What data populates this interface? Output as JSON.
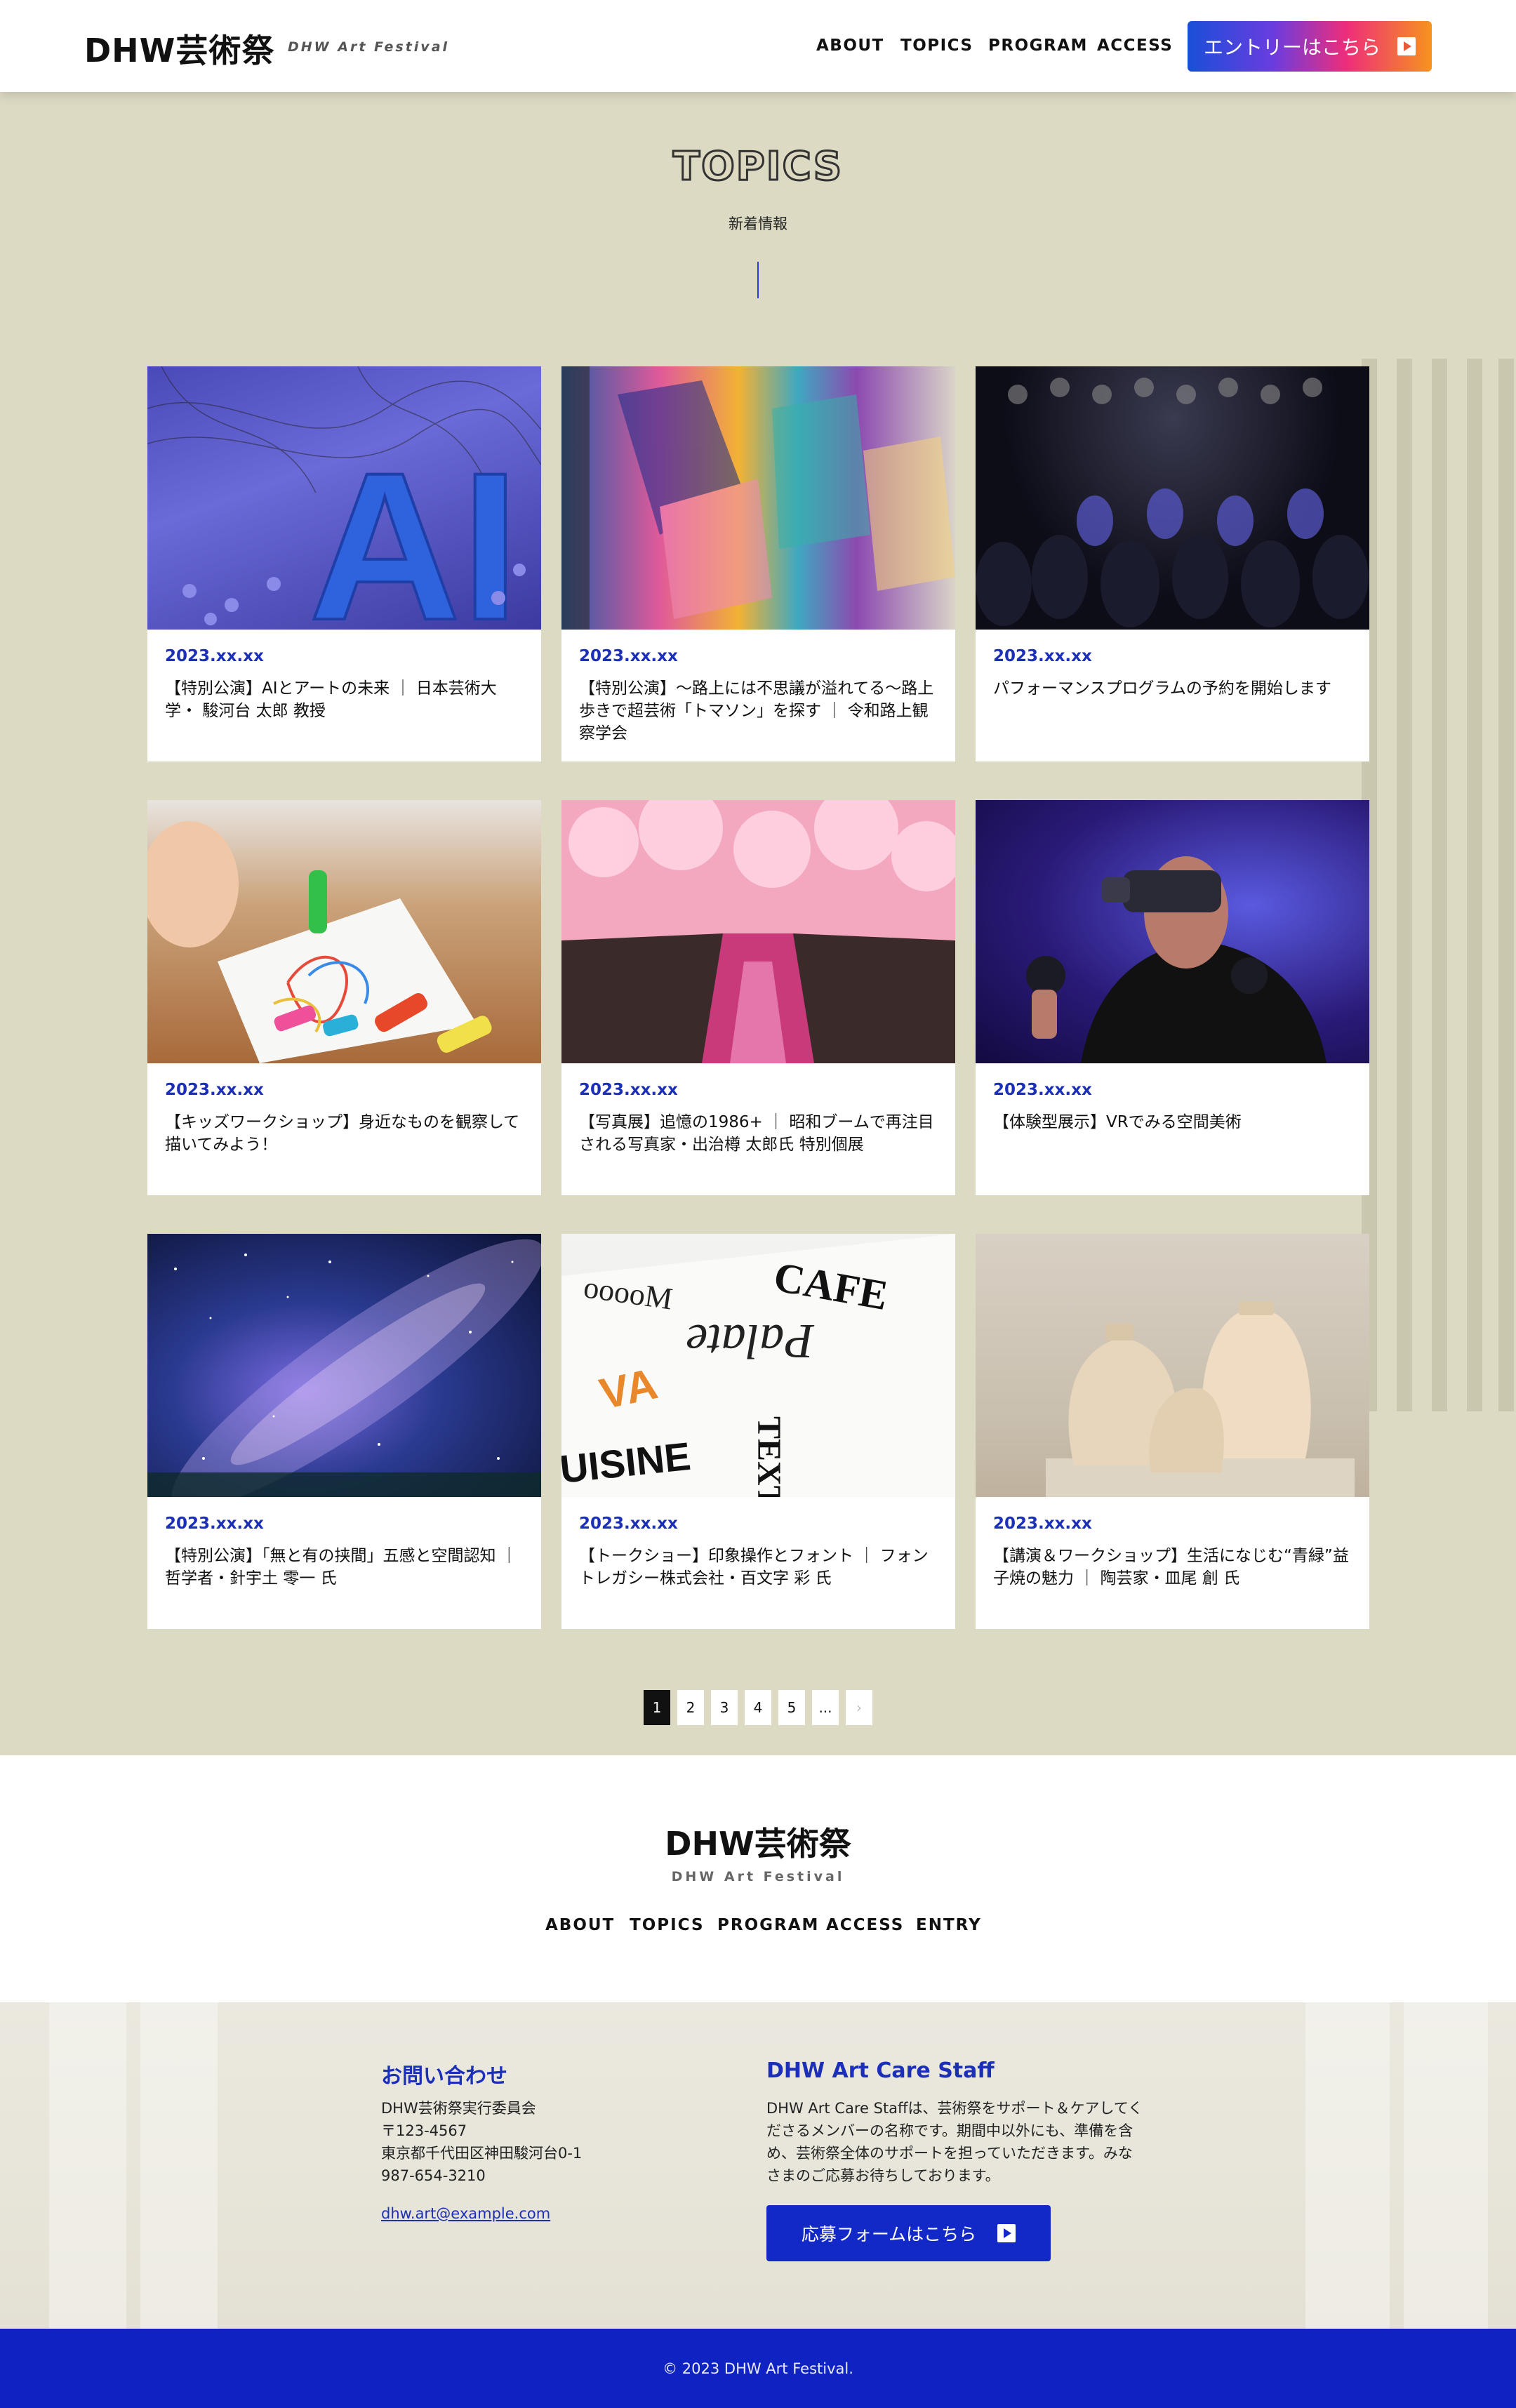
{
  "header": {
    "logo": "DHW芸術祭",
    "logo_sub": "DHW Art Festival",
    "nav": [
      "ABOUT",
      "TOPICS",
      "PROGRAM",
      "ACCESS"
    ],
    "entry_button": "エントリーはこちら"
  },
  "topics": {
    "title": "TOPICS",
    "subtitle": "新着情報",
    "cards": [
      {
        "date": "2023.xx.xx",
        "title": "【特別公演】AIとアートの未来 ｜ 日本芸術大学・ 駿河台 太郎 教授",
        "image": "ai-3d-letters"
      },
      {
        "date": "2023.xx.xx",
        "title": "【特別公演】〜路上には不思議が溢れてる〜路上歩きで超芸術「トマソン」を探す ｜ 令和路上観察学会",
        "image": "street-mural"
      },
      {
        "date": "2023.xx.xx",
        "title": "パフォーマンスプログラムの予約を開始します",
        "image": "audience-hall"
      },
      {
        "date": "2023.xx.xx",
        "title": "【キッズワークショップ】身近なものを観察して描いてみよう！",
        "image": "child-drawing"
      },
      {
        "date": "2023.xx.xx",
        "title": "【写真展】追憶の1986+ ｜ 昭和ブームで再注目される写真家・出治樽 太郎氏 特別個展",
        "image": "cherry-blossom-river"
      },
      {
        "date": "2023.xx.xx",
        "title": "【体験型展示】VRでみる空間美術",
        "image": "vr-headset-man"
      },
      {
        "date": "2023.xx.xx",
        "title": "【特別公演】「無と有の挟間」五感と空間認知 ｜ 哲学者・針宇土 零一 氏",
        "image": "milky-way"
      },
      {
        "date": "2023.xx.xx",
        "title": "【トークショー】印象操作とフォント ｜ フォントレガシー株式会社・百文字 彩 氏",
        "image": "typography-book"
      },
      {
        "date": "2023.xx.xx",
        "title": "【講演＆ワークショップ】生活になじむ“青緑”益子焼の魅力 ｜ 陶芸家・皿尾 創 氏",
        "image": "ceramic-vases"
      }
    ],
    "pagination": [
      "1",
      "2",
      "3",
      "4",
      "5",
      "...",
      "›"
    ]
  },
  "footer": {
    "logo": "DHW芸術祭",
    "logo_sub": "DHW Art Festival",
    "nav": [
      "ABOUT",
      "TOPICS",
      "PROGRAM",
      "ACCESS",
      "ENTRY"
    ],
    "contact": {
      "heading": "お問い合わせ",
      "org": "DHW芸術祭実行委員会",
      "zip": "〒123-4567",
      "address": "東京都千代田区神田駿河台0-1",
      "phone": "987-654-3210",
      "email": "dhw.art@example.com"
    },
    "staff": {
      "heading": "DHW Art Care Staff",
      "line1": "DHW Art Care Staffは、芸術祭をサポート＆ケアしてく",
      "line2": "ださるメンバーの名称です。期間中以外にも、準備を含",
      "line3": "め、芸術祭全体のサポートを担っていただきます。みな",
      "line4": "さまのご応募お待ちしております。",
      "button": "応募フォームはこちら"
    },
    "copyright": "© 2023 DHW Art Festival."
  },
  "colors": {
    "accent": "#1c2fb8",
    "section_bg": "#dcdac3",
    "footer_bar": "#0f22c2"
  }
}
